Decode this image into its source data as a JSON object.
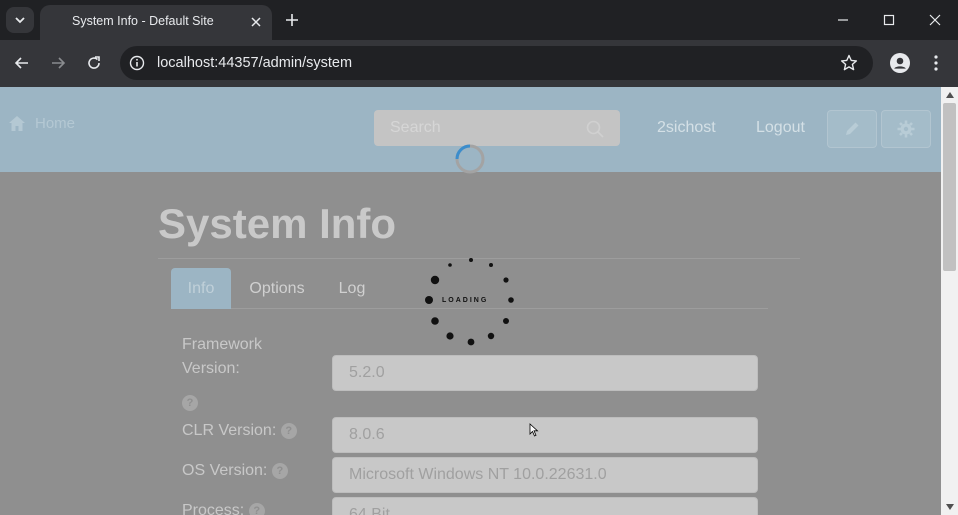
{
  "browser": {
    "tab_title": "System Info - Default Site",
    "url": "localhost:44357/admin/system"
  },
  "header": {
    "home_label": "Home",
    "search_placeholder": "Search",
    "user_label": "2sichost",
    "logout_label": "Logout"
  },
  "page": {
    "title": "System Info",
    "tabs": [
      {
        "label": "Info",
        "active": true
      },
      {
        "label": "Options",
        "active": false
      },
      {
        "label": "Log",
        "active": false
      }
    ],
    "fields": [
      {
        "label_line1": "Framework",
        "label_line2": "Version:",
        "value": "5.2.0"
      },
      {
        "label": "CLR Version:",
        "value": "8.0.6"
      },
      {
        "label": "OS Version:",
        "value": "Microsoft Windows NT 10.0.22631.0"
      },
      {
        "label": "Process:",
        "value": "64 Bit"
      }
    ]
  },
  "overlay": {
    "loading_text": "LOADING"
  },
  "colors": {
    "header_bg": "#9cb5c4",
    "page_overlay": "#8f8f8f",
    "chrome_dark": "#202124"
  },
  "icons": [
    "tab-search-icon",
    "close-icon",
    "plus-icon",
    "minimize-icon",
    "maximize-icon",
    "back-icon",
    "forward-icon",
    "reload-icon",
    "site-info-icon",
    "star-icon",
    "profile-icon",
    "more-icon",
    "home-icon",
    "search-icon",
    "pencil-icon",
    "gear-icon",
    "help-icon"
  ]
}
